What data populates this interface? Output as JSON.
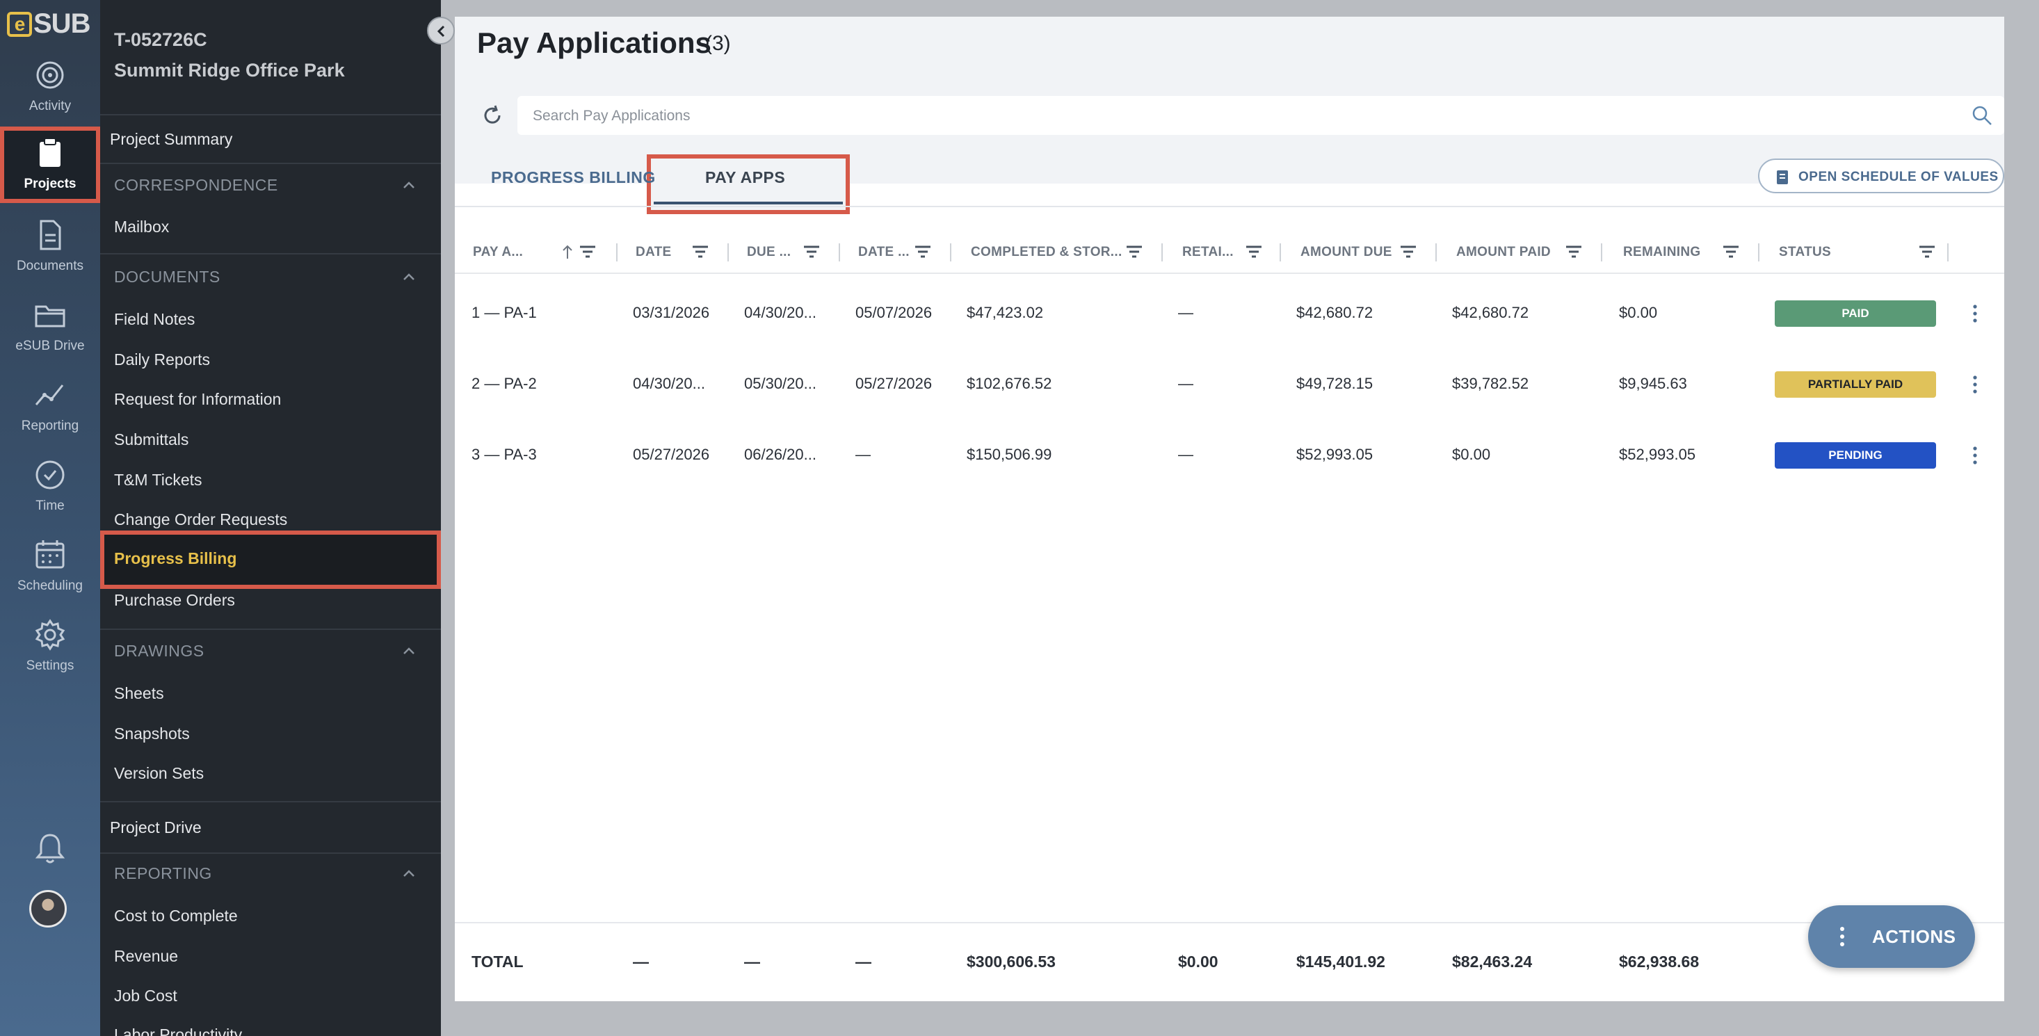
{
  "rail": {
    "logo_e": "e",
    "logo_sub": "SUB",
    "items": [
      {
        "label": "Activity",
        "icon": "activity-icon"
      },
      {
        "label": "Projects",
        "icon": "clipboard-icon"
      },
      {
        "label": "Documents",
        "icon": "document-icon"
      },
      {
        "label": "eSUB Drive",
        "icon": "folder-icon"
      },
      {
        "label": "Reporting",
        "icon": "chart-line-icon"
      },
      {
        "label": "Time",
        "icon": "clock-icon"
      },
      {
        "label": "Scheduling",
        "icon": "calendar-icon"
      },
      {
        "label": "Settings",
        "icon": "gear-icon"
      }
    ]
  },
  "project": {
    "id": "T-052726C",
    "name": "Summit Ridge Office Park"
  },
  "nav": {
    "project_summary": "Project Summary",
    "correspondence": "CORRESPONDENCE",
    "mailbox": "Mailbox",
    "documents": "DOCUMENTS",
    "doc_items": [
      "Field Notes",
      "Daily Reports",
      "Request for Information",
      "Submittals",
      "T&M Tickets",
      "Change Order Requests",
      "Progress Billing",
      "Purchase Orders"
    ],
    "drawings": "DRAWINGS",
    "drawing_items": [
      "Sheets",
      "Snapshots",
      "Version Sets"
    ],
    "project_drive": "Project Drive",
    "reporting": "REPORTING",
    "reporting_items": [
      "Cost to Complete",
      "Revenue",
      "Job Cost",
      "Labor Productivity"
    ]
  },
  "main": {
    "title": "Pay Applications",
    "count": "(3)",
    "search_placeholder": "Search Pay Applications",
    "tabs": [
      "PROGRESS BILLING",
      "PAY APPS"
    ],
    "open_sov": "OPEN SCHEDULE OF VALUES",
    "actions": "ACTIONS"
  },
  "table": {
    "headers": [
      "PAY A...",
      "DATE",
      "DUE ...",
      "DATE ...",
      "COMPLETED & STOR...",
      "RETAI...",
      "AMOUNT DUE",
      "AMOUNT PAID",
      "REMAINING",
      "STATUS"
    ],
    "rows": [
      {
        "pay_app": "1 — PA-1",
        "date": "03/31/2026",
        "due": "04/30/20...",
        "date2": "05/07/2026",
        "completed": "$47,423.02",
        "retainage": "—",
        "amount_due": "$42,680.72",
        "amount_paid": "$42,680.72",
        "remaining": "$0.00",
        "status": "PAID",
        "status_bg": "#5a9a76",
        "status_fg": "#ffffff"
      },
      {
        "pay_app": "2 — PA-2",
        "date": "04/30/20...",
        "due": "05/30/20...",
        "date2": "05/27/2026",
        "completed": "$102,676.52",
        "retainage": "—",
        "amount_due": "$49,728.15",
        "amount_paid": "$39,782.52",
        "remaining": "$9,945.63",
        "status": "PARTIALLY PAID",
        "status_bg": "#e0c25a",
        "status_fg": "#1f2329"
      },
      {
        "pay_app": "3 — PA-3",
        "date": "05/27/2026",
        "due": "06/26/20...",
        "date2": "—",
        "completed": "$150,506.99",
        "retainage": "—",
        "amount_due": "$52,993.05",
        "amount_paid": "$0.00",
        "remaining": "$52,993.05",
        "status": "PENDING",
        "status_bg": "#2352c4",
        "status_fg": "#ffffff"
      }
    ],
    "total": {
      "label": "TOTAL",
      "date": "—",
      "due": "—",
      "date2": "—",
      "completed": "$300,606.53",
      "retainage": "$0.00",
      "amount_due": "$145,401.92",
      "amount_paid": "$82,463.24",
      "remaining": "$62,938.68"
    }
  },
  "colors": {
    "accent": "#4a6a8e",
    "highlight": "#d65a4a",
    "active_nav": "#e7c04a"
  }
}
